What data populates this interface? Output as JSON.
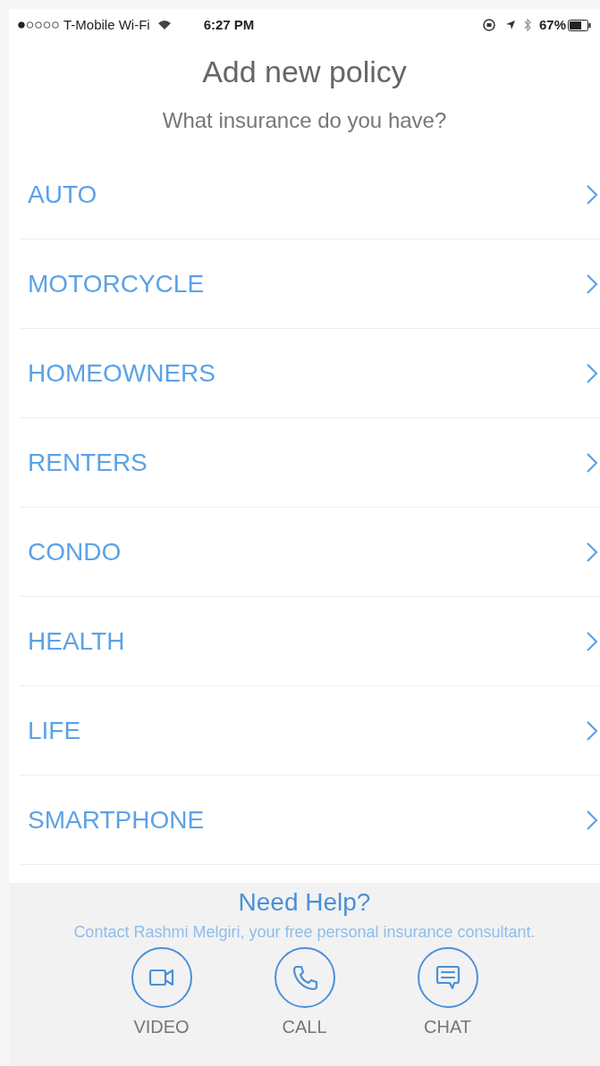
{
  "status_bar": {
    "carrier": "T-Mobile Wi-Fi",
    "time": "6:27 PM",
    "battery": "67%"
  },
  "title": "Add new policy",
  "subtitle": "What insurance do you have?",
  "policies": [
    {
      "label": "AUTO"
    },
    {
      "label": "MOTORCYCLE"
    },
    {
      "label": "HOMEOWNERS"
    },
    {
      "label": "RENTERS"
    },
    {
      "label": "CONDO"
    },
    {
      "label": "HEALTH"
    },
    {
      "label": "LIFE"
    },
    {
      "label": "SMARTPHONE"
    }
  ],
  "help": {
    "title": "Need Help?",
    "text": "Contact Rashmi Melgiri, your free personal insurance consultant.",
    "actions": [
      {
        "kind": "video",
        "label": "VIDEO"
      },
      {
        "kind": "call",
        "label": "CALL"
      },
      {
        "kind": "chat",
        "label": "CHAT"
      }
    ]
  }
}
